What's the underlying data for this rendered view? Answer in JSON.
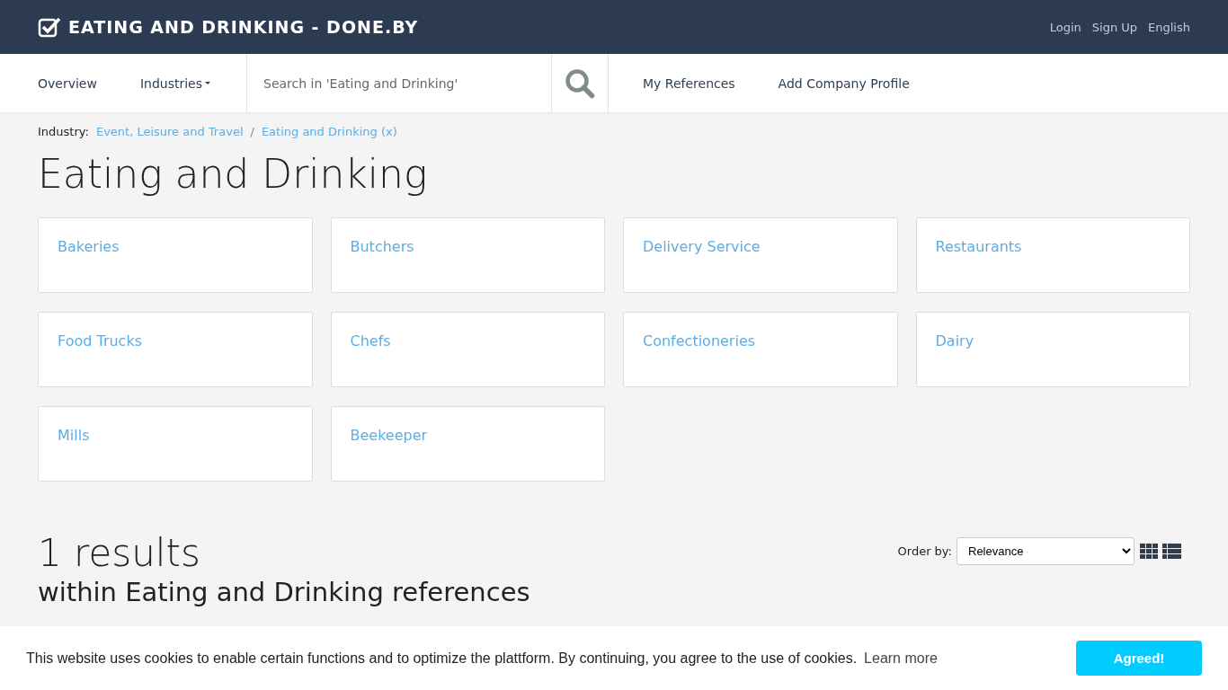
{
  "header": {
    "title": "EATING AND DRINKING - DONE.BY",
    "links": [
      "Login",
      "Sign Up",
      "English"
    ]
  },
  "nav": {
    "items": [
      {
        "label": "Overview",
        "kind": "link"
      },
      {
        "label": "Industries",
        "kind": "dropdown"
      }
    ],
    "search": {
      "placeholder": "Search in 'Eating and Drinking'"
    },
    "right_items": [
      "My References",
      "Add Company Profile"
    ]
  },
  "breadcrumb": {
    "label": "Industry:",
    "items": [
      "Event, Leisure and Travel",
      "Eating and Drinking (x)"
    ],
    "separator": "/"
  },
  "page_title": "Eating and Drinking",
  "categories": [
    "Bakeries",
    "Butchers",
    "Delivery Service",
    "Restaurants",
    "Food Trucks",
    "Chefs",
    "Confectioneries",
    "Dairy",
    "Mills",
    "Beekeeper"
  ],
  "results": {
    "count": "1 results",
    "subtitle": "within Eating and Drinking references",
    "order_label": "Order by:",
    "order_value": "Relevance",
    "views": [
      {
        "kind": "grid",
        "selected": false
      },
      {
        "kind": "list",
        "selected": false
      }
    ]
  },
  "cookie_banner": {
    "text": "This website uses cookies to enable certain functions and to optimize the plattform. By continuing, you agree to the use of cookies.",
    "link": "Learn more",
    "button": "Agreed!"
  }
}
